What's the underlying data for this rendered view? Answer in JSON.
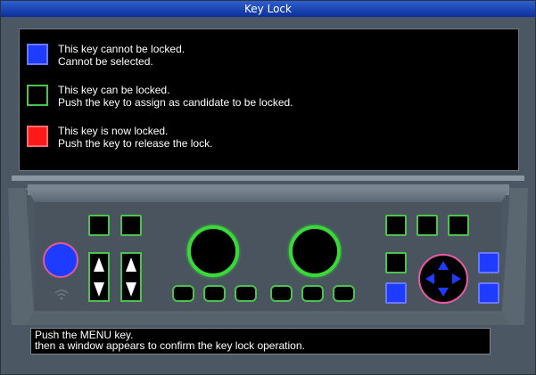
{
  "window": {
    "title": "Key Lock"
  },
  "legend": [
    {
      "color": "#1e3cff",
      "border": "#6a78ff",
      "line1": "This key cannot be locked.",
      "line2": "Cannot be selected."
    },
    {
      "color": "#000000",
      "border": "#4cc34c",
      "line1": "This key can be locked.",
      "line2": "Push the key to assign as candidate to be locked."
    },
    {
      "color": "#ff1a1a",
      "border": "#ff6a6a",
      "line1": "This key is now locked.",
      "line2": "Push the key to release the lock."
    }
  ],
  "message": {
    "line1": "Push the MENU key.",
    "line2": "then a window appears to confirm the key lock operation."
  },
  "icons": {
    "power": "power-button-icon",
    "wifi": "wifi-icon",
    "dpad": "dpad-icon"
  },
  "colors": {
    "title_bar": "#1f49c2",
    "key_border_lockable": "#4cc34c",
    "key_unlockable": "#1e3cff",
    "key_locked": "#ff1a1a"
  }
}
